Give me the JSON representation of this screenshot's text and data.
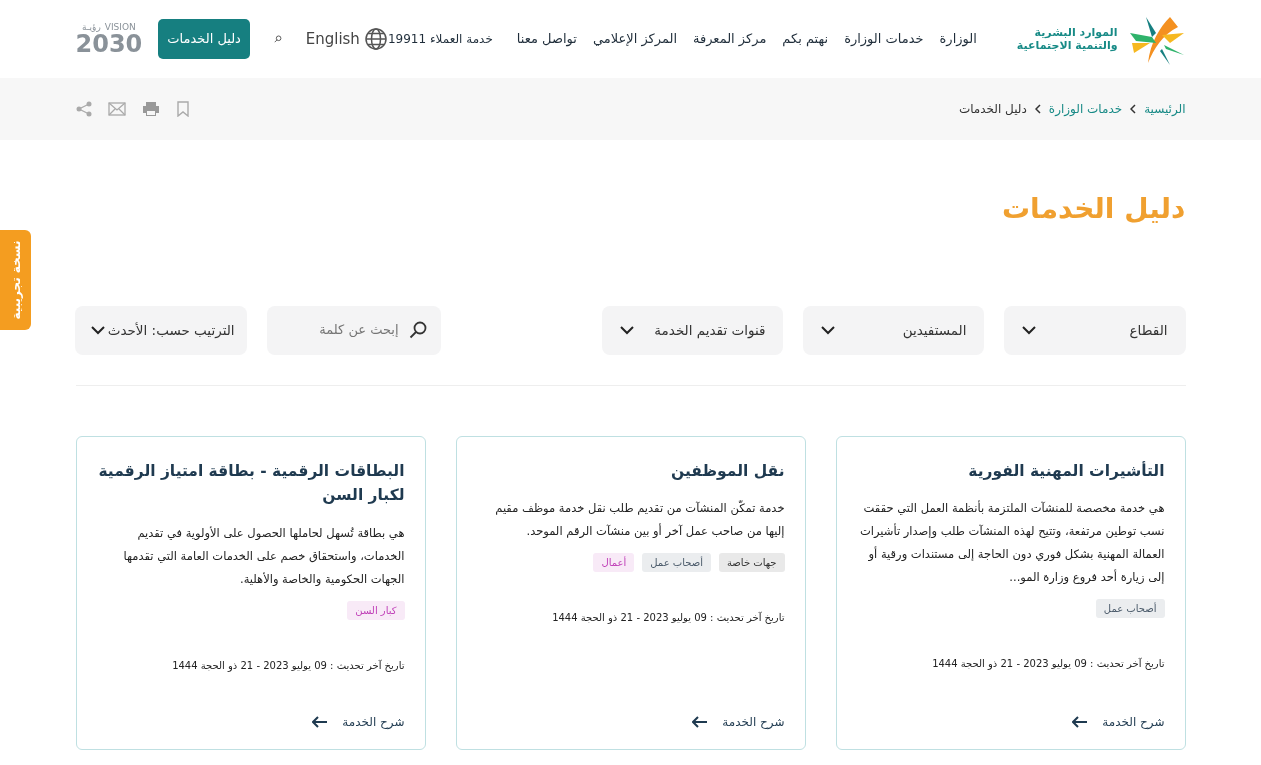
{
  "header": {
    "logo_text": [
      "الموارد البشرية",
      "والتنمية الاجتماعية"
    ],
    "nav": [
      {
        "label": "الوزارة"
      },
      {
        "label": "خدمات الوزارة"
      },
      {
        "label": "نهتم بكم"
      },
      {
        "label": "مركز المعرفة"
      },
      {
        "label": "المركز الإعلامي"
      },
      {
        "label": "تواصل معنا"
      }
    ],
    "customer_service": "خدمة العملاء 19911",
    "language": "English",
    "guide_button": "دليل الخدمات",
    "vision_logo": {
      "word": "VISION",
      "arabic": "رؤيـة",
      "year": "2030"
    }
  },
  "breadcrumb": [
    {
      "label": "الرئيسية"
    },
    {
      "label": "خدمات الوزارة"
    },
    {
      "label": "دليل الخدمات"
    }
  ],
  "side_tab": "نسخة تجريبية",
  "page_title": "دليل الخدمات",
  "filters": [
    {
      "label": "القطاع"
    },
    {
      "label": "المستفيدين"
    },
    {
      "label": "قنوات تقديم الخدمة"
    }
  ],
  "search": {
    "placeholder": "إبحث عن كلمة"
  },
  "sort": "الترتيب حسب: الأحدث",
  "cards": [
    {
      "title": "التأشيرات المهنية الفورية",
      "description": "هي خدمة مخصصة للمنشآت الملتزمة بأنظمة العمل التي حققت نسب توطين مرتفعة، وتتيح لهذه المنشآت طلب وإصدار تأشيرات العمالة المهنية بشكل فوري دون الحاجة إلى مستندات ورقية أو إلى زيارة أحد فروع وزارة المو...",
      "tags": [
        {
          "label": "أصحاب عمل",
          "color": "#4a5a6a"
        }
      ],
      "updated": "تاريخ آخر تحديث : 09 يوليو 2023 - 21 ذو الحجة 1444",
      "link": "شرح الخدمة"
    },
    {
      "title": "نقل الموظفين",
      "description": "خدمة تمكّن المنشآت من تقديم طلب نقل خدمة موظف مقيم إليها من صاحب عمل آخر أو بين منشآت الرقم الموحد.",
      "tags": [
        {
          "label": "جهات خاصة",
          "color": "#333333"
        },
        {
          "label": "أصحاب عمل",
          "color": "#4a5a6a"
        },
        {
          "label": "أعمال",
          "color": "#c040b8"
        }
      ],
      "updated": "تاريخ آخر تحديث : 09 يوليو 2023 - 21 ذو الحجة 1444",
      "link": "شرح الخدمة"
    },
    {
      "title": "البطاقات الرقمية - بطاقة امتياز الرقمية لكبار السن",
      "description": "هي بطاقة تُسهل لحاملها الحصول على الأولوية في تقديم الخدمات، واستحقاق خصم على الخدمات العامة التي تقدمها الجهات الحكومية والخاصة والأهلية.",
      "tags": [
        {
          "label": "كبار السن",
          "color": "#c040b8"
        }
      ],
      "updated": "تاريخ آخر تحديث : 09 يوليو 2023 - 21 ذو الحجة 1444",
      "link": "شرح الخدمة"
    }
  ]
}
